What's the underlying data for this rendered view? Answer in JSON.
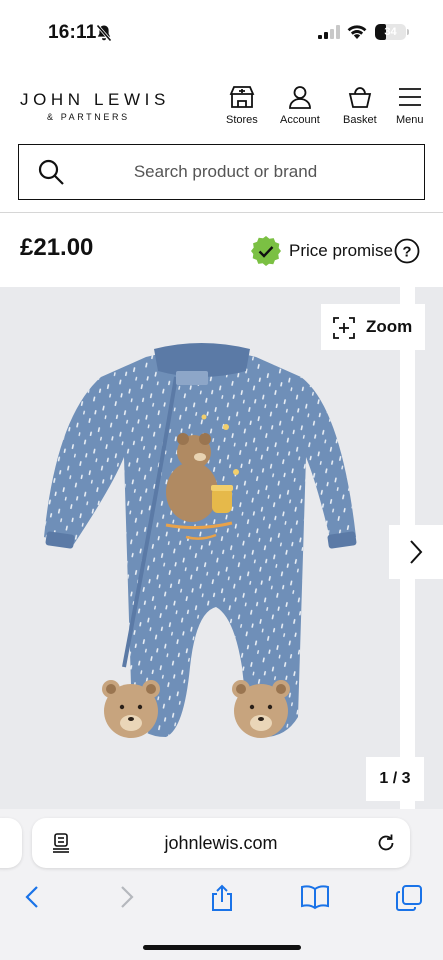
{
  "status_bar": {
    "time": "16:11",
    "battery_level": 34,
    "battery_text": "34",
    "icons": [
      "bell-off-icon",
      "signal-icon",
      "wifi-icon",
      "battery-icon"
    ]
  },
  "header": {
    "logo_main": "JOHN LEWIS",
    "logo_sub": "& PARTNERS",
    "nav": [
      {
        "label": "Stores",
        "icon": "store-icon"
      },
      {
        "label": "Account",
        "icon": "account-icon"
      },
      {
        "label": "Basket",
        "icon": "basket-icon"
      },
      {
        "label": "Menu",
        "icon": "menu-icon"
      }
    ]
  },
  "search": {
    "placeholder": "Search product or brand",
    "icon": "search-icon"
  },
  "product": {
    "price": "£21.00",
    "price_promise_label": "Price promise",
    "accent_green": "#7bc043"
  },
  "gallery": {
    "zoom_label": "Zoom",
    "page_indicator": "1 / 3",
    "background": "#e9eaed",
    "garment_color": "#6f8fb8"
  },
  "browser": {
    "url": "johnlewis.com",
    "accent": "#1a73e8",
    "toolbar": [
      "back-icon",
      "forward-icon",
      "share-icon",
      "bookmarks-icon",
      "tabs-icon"
    ]
  }
}
